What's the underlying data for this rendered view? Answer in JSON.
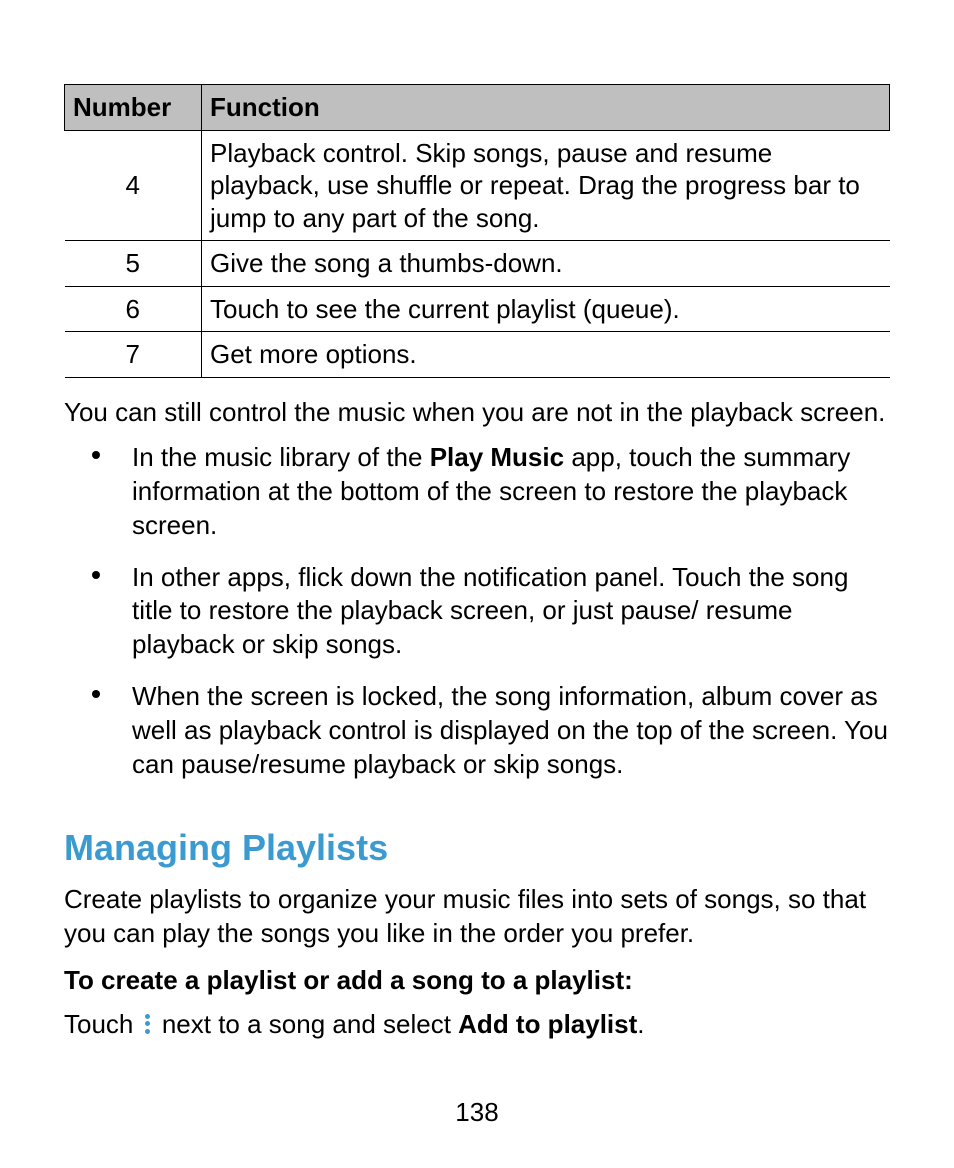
{
  "table": {
    "headers": [
      "Number",
      "Function"
    ],
    "rows": [
      {
        "num": "4",
        "desc": "Playback control. Skip songs, pause and resume playback, use shuffle or repeat. Drag the progress bar to jump to any part of the song."
      },
      {
        "num": "5",
        "desc": "Give the song a thumbs-down."
      },
      {
        "num": "6",
        "desc": "Touch to see the current playlist (queue)."
      },
      {
        "num": "7",
        "desc": "Get more options."
      }
    ]
  },
  "para_after_table": "You can still control the music when you are not in the playback screen.",
  "bullets": {
    "b1a": "In the music library of the ",
    "b1b": "Play Music",
    "b1c": " app, touch the summary information at the bottom of the screen to restore the playback screen.",
    "b2": "In other apps, flick down the notification panel. Touch the song title to restore the playback screen, or just pause/ resume playback or skip songs.",
    "b3": "When the screen is locked, the song information, album cover as well as playback control is displayed on the top of the screen. You can pause/resume playback or skip songs."
  },
  "section_heading": "Managing Playlists",
  "section_intro": "Create playlists to organize your music files into sets of songs, so that you can play the songs you like in the order you prefer.",
  "sub_heading": "To create a playlist or add a song to a playlist:",
  "instr": {
    "pre": "Touch ",
    "mid": " next to a song and select ",
    "bold": "Add to playlist",
    "post": "."
  },
  "page_number": "138"
}
